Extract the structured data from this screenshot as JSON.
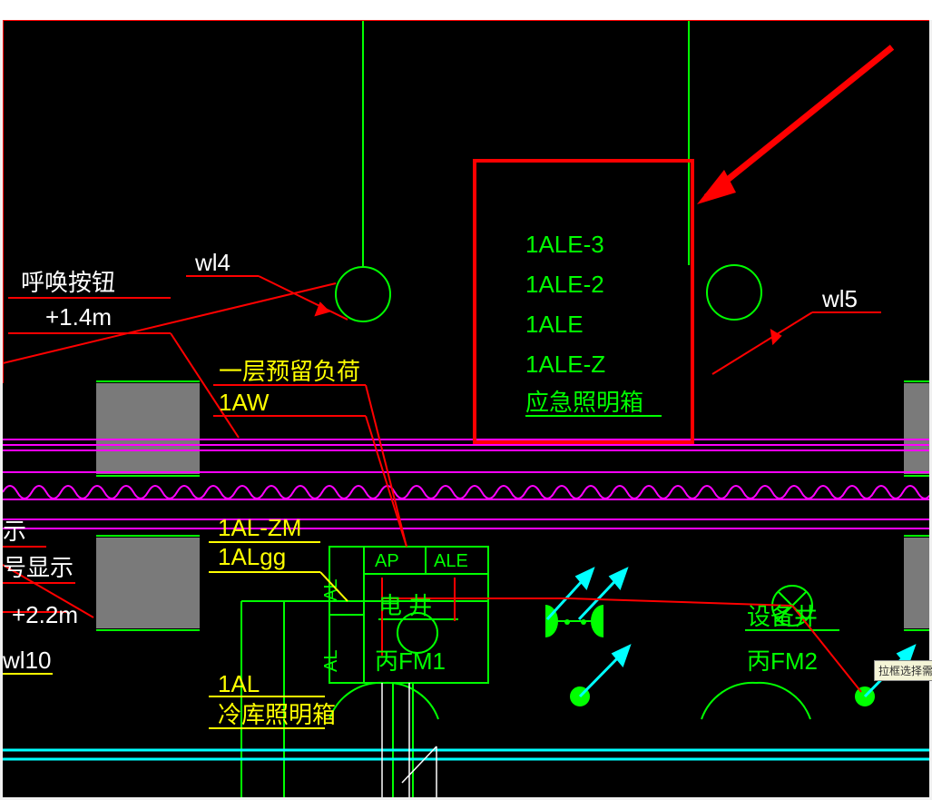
{
  "highlight": {
    "lines": [
      "1ALE-3",
      "1ALE-2",
      "1ALE",
      "1ALE-Z",
      "应急照明箱"
    ]
  },
  "labels": {
    "call_button": "呼唤按钮",
    "call_button_h": "+1.4m",
    "wl4": "wl4",
    "wl5": "wl5",
    "reserve_load": "一层预留负荷",
    "one_aw": "1AW",
    "one_al_zm": "1AL-ZM",
    "one_algg": "1ALgg",
    "one_al": "1AL",
    "cold_storage": "冷库照明箱",
    "signal_suffix": "示",
    "signal_display": "号显示",
    "h22": "+2.2m",
    "wl10": "wl10",
    "ap": "AP",
    "ale": "ALE",
    "al_v1": "AL",
    "al_v2": "AL",
    "shaft_elec": "电   井",
    "fm1": "丙FM1",
    "equip_shaft": "设备井",
    "fm2": "丙FM2",
    "tooltip": "拉框选择需要提取"
  },
  "colors": {
    "red": "#ff0000",
    "green": "#00ff00",
    "yellow": "#ffff00",
    "magenta": "#ff00ff",
    "cyan": "#00ffff",
    "white": "#ffffff",
    "grey": "#7a7a7a"
  }
}
